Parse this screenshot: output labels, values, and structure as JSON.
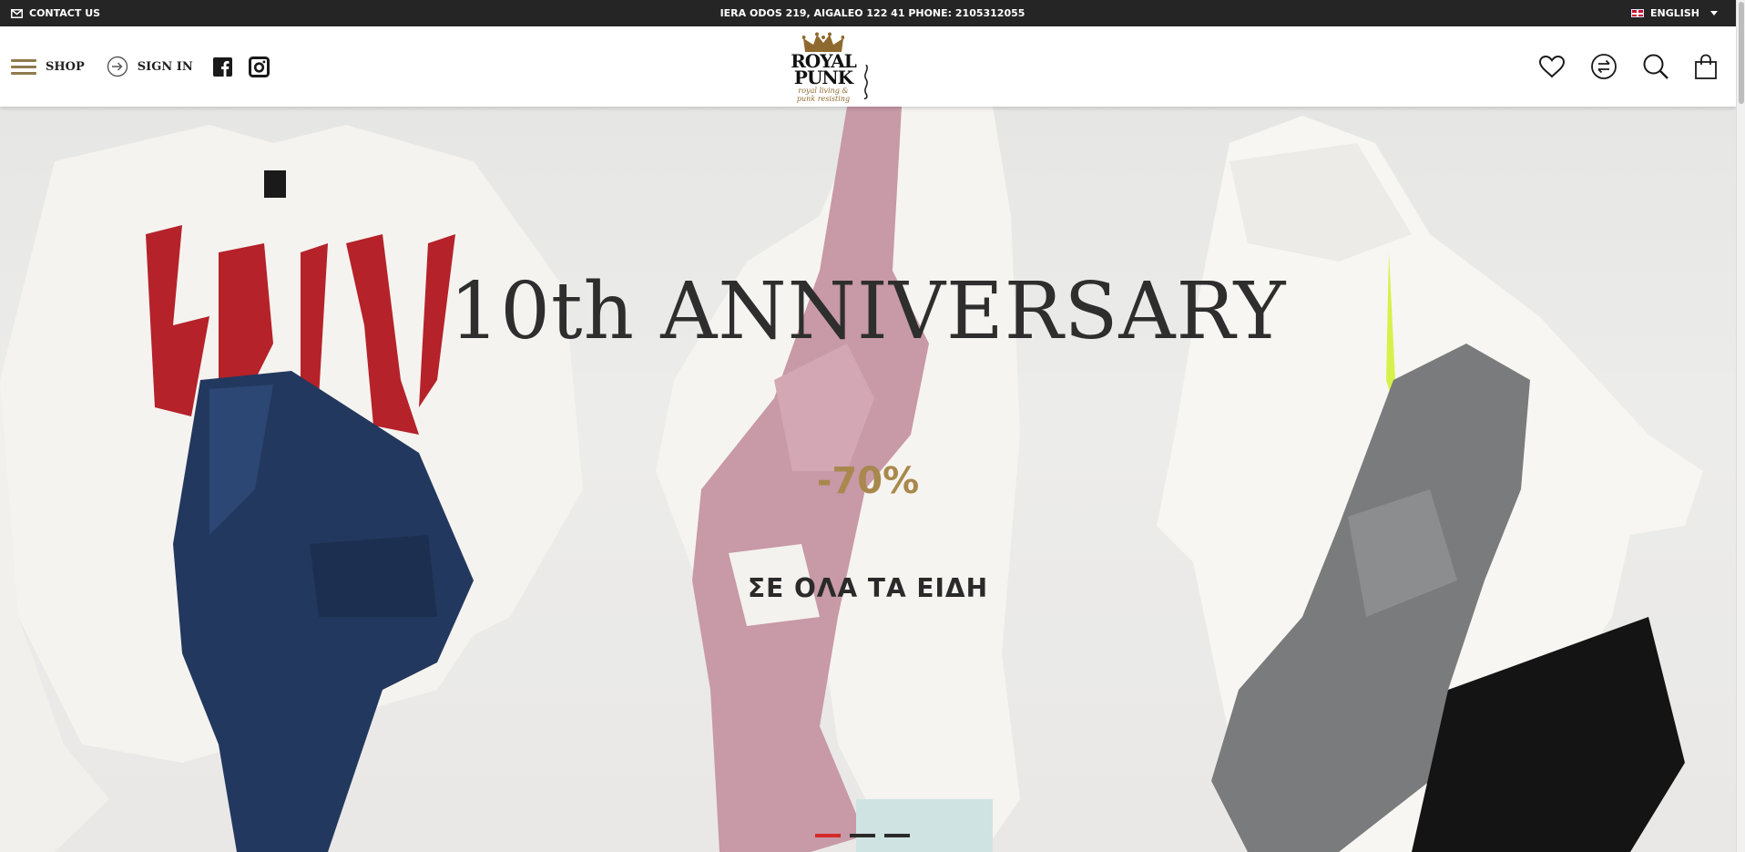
{
  "topbar": {
    "contact_label": "CONTACT US",
    "address": "IERA ODOS 219, AIGALEO 122 41 PHONE: 2105312055",
    "language": "ENGLISH"
  },
  "header": {
    "shop_label": "SHOP",
    "signin_label": "SIGN IN",
    "logo": {
      "line1": "ROYAL",
      "line2": "PUNK",
      "tagline1": "royal living &",
      "tagline2": "punk resisting"
    },
    "icons": [
      "heart-icon",
      "compare-icon",
      "search-icon",
      "shopping-bag-icon"
    ]
  },
  "hero": {
    "headline": "10th ANNIVERSARY",
    "discount": "-70%",
    "subline": "ΣΕ ΟΛΑ ΤΑ ΕΙΔΗ",
    "slides": 3,
    "active_slide": 1,
    "colors": {
      "discount": "#a8884d",
      "active_dot": "#d32a2a",
      "accent_gold": "#8f7a4e"
    }
  }
}
